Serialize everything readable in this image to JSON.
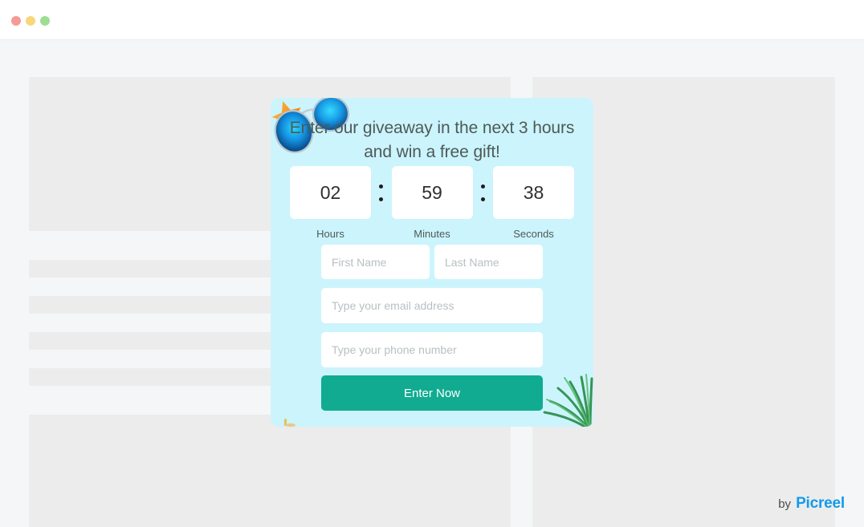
{
  "window": {
    "dots": [
      {
        "name": "close-dot",
        "color": "#f49b95"
      },
      {
        "name": "minimize-dot",
        "color": "#f8d67a"
      },
      {
        "name": "maximize-dot",
        "color": "#9ede93"
      }
    ]
  },
  "page": {
    "background_color": "#f5f6f7",
    "skeleton_block_color": "#ececec"
  },
  "modal": {
    "background_color": "#ccf4fd",
    "title": "Enter our giveaway in the next 3 hours and win a free gift!",
    "decorations": [
      {
        "name": "sunglasses-starfish-icon",
        "colors": [
          "#f79a2b",
          "#0d7fd4",
          "#16c0f5"
        ]
      },
      {
        "name": "palm-leaf-icon",
        "colors": [
          "#2f8f4e",
          "#5bbf72"
        ]
      },
      {
        "name": "sand-speck-icon",
        "colors": [
          "#e3c45a",
          "#eac98b"
        ]
      }
    ],
    "countdown": {
      "units": [
        {
          "value": "02",
          "label": "Hours"
        },
        {
          "value": "59",
          "label": "Minutes"
        },
        {
          "value": "38",
          "label": "Seconds"
        }
      ],
      "separator": ":"
    },
    "form": {
      "first_name_placeholder": "First Name",
      "last_name_placeholder": "Last Name",
      "email_placeholder": "Type your email address",
      "phone_placeholder": "Type your phone number",
      "first_name_value": "",
      "last_name_value": "",
      "email_value": "",
      "phone_value": "",
      "submit_label": "Enter Now",
      "submit_color": "#11ab91"
    }
  },
  "footer": {
    "by_label": "by",
    "brand_name": "Picreel",
    "brand_color": "#139aea"
  }
}
